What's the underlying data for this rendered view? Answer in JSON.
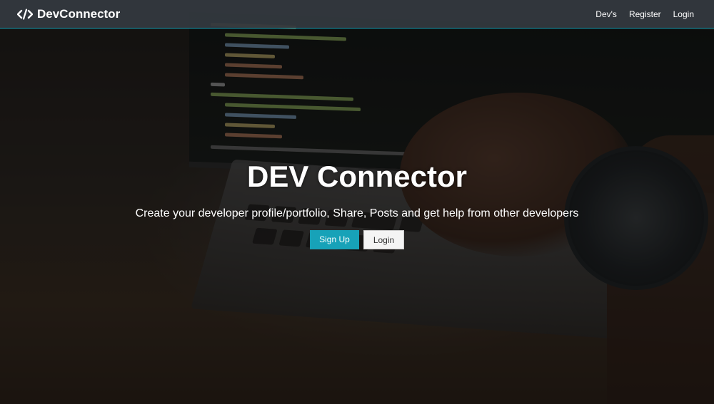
{
  "navbar": {
    "brand_icon": "code-icon",
    "brand_label": "DevConnector",
    "links": [
      "Dev's",
      "Register",
      "Login"
    ],
    "accent_color": "#17a2b8"
  },
  "hero": {
    "title": "DEV Connector",
    "lead": "Create your developer profile/portfolio, Share, Posts and get help from other developers",
    "signup_label": "Sign Up",
    "login_label": "Login"
  },
  "colors": {
    "primary": "#17a2b8",
    "navbar_bg": "#343a40",
    "light_button": "#f4f4f4"
  }
}
